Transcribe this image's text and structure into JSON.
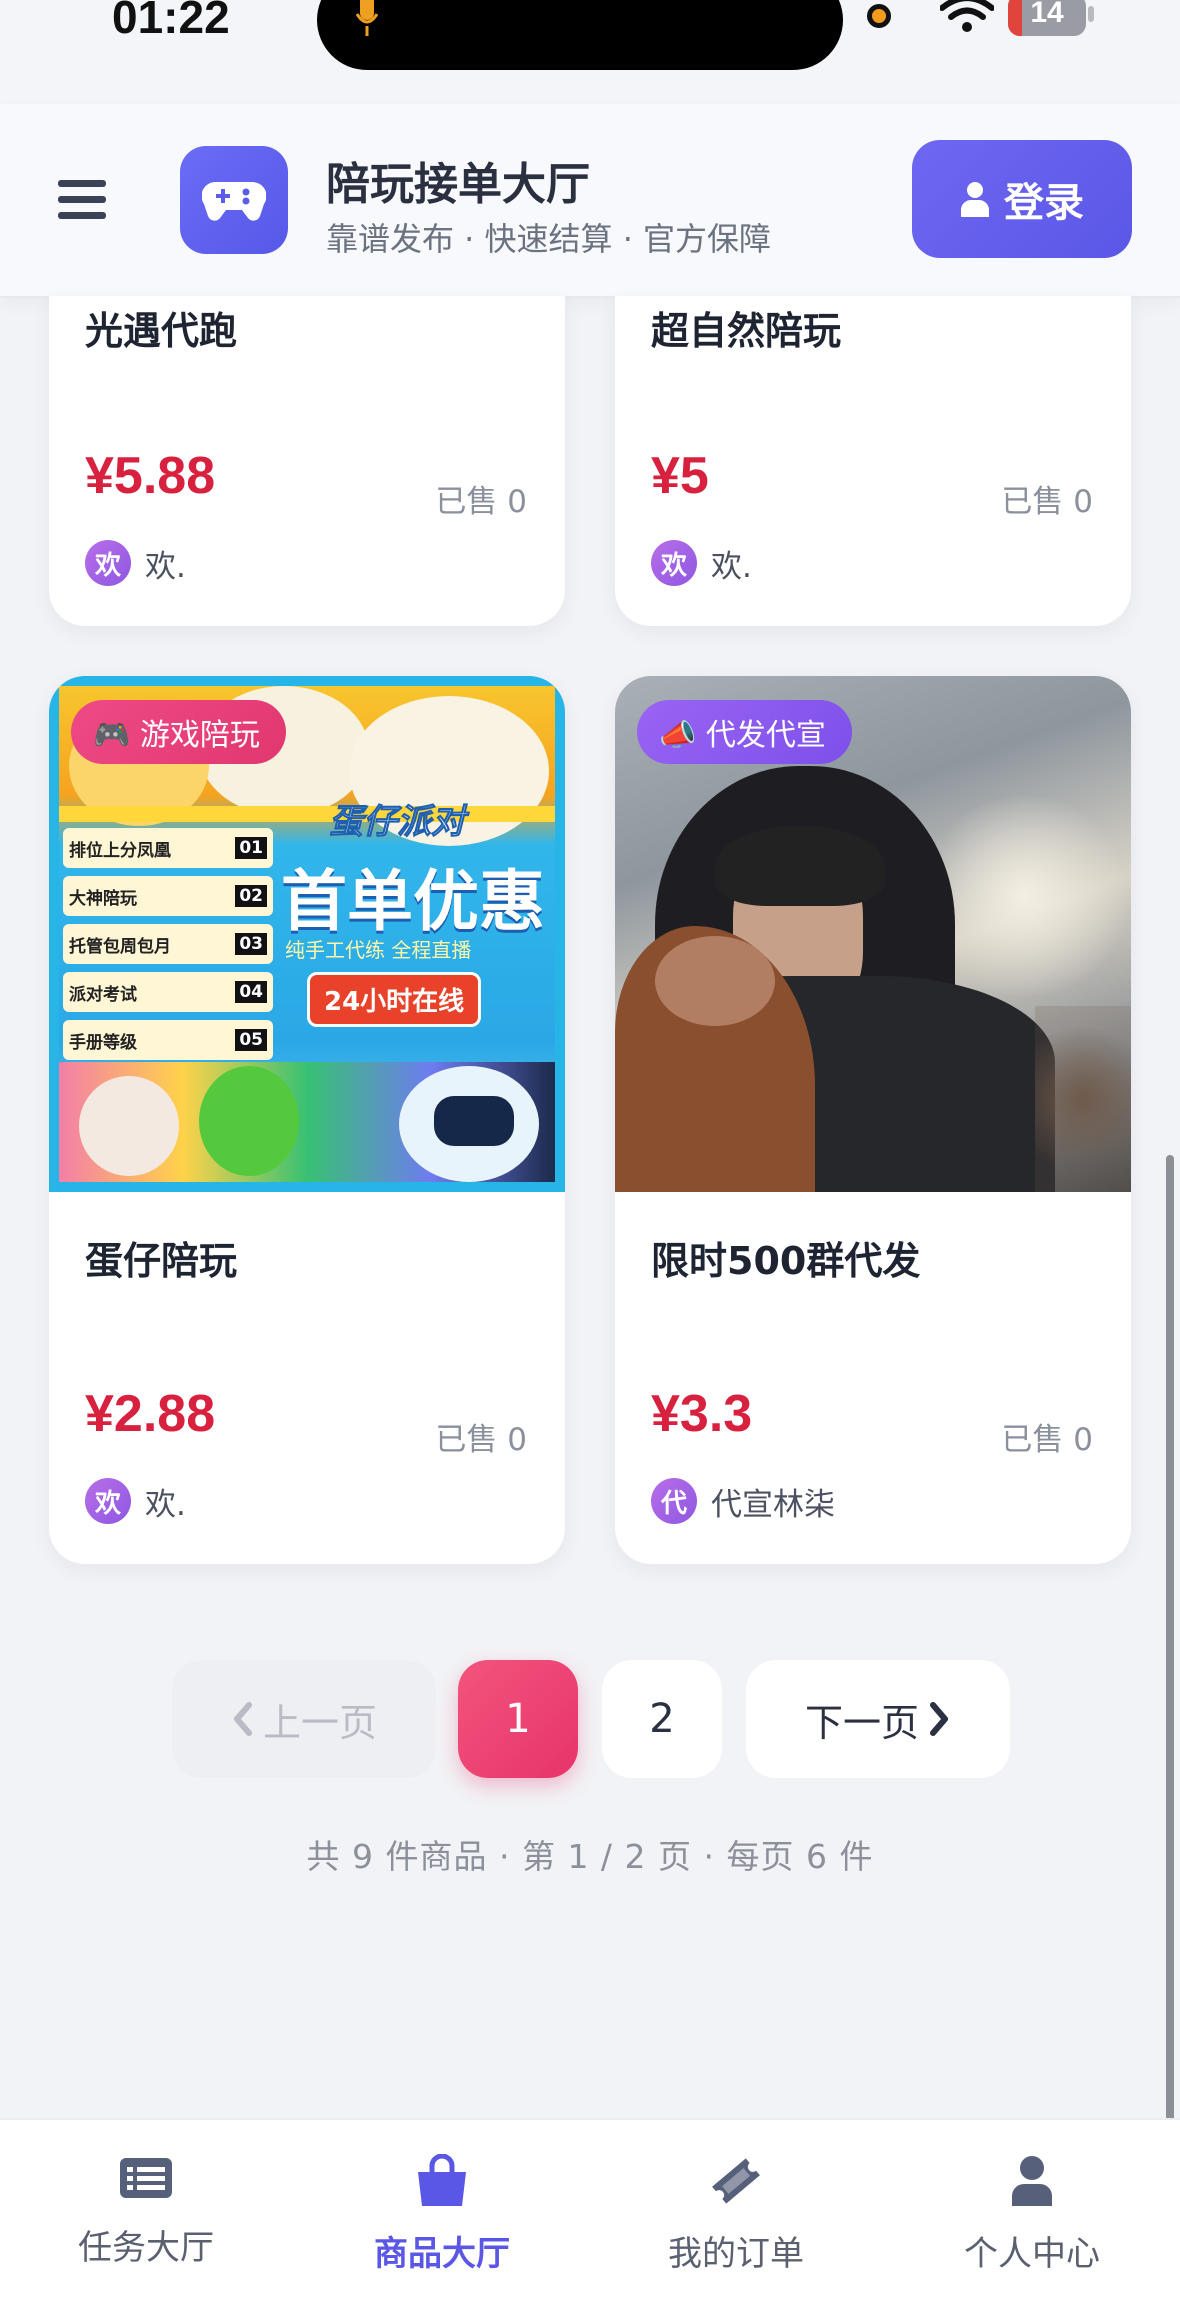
{
  "status": {
    "time": "01:22",
    "battery": "14"
  },
  "header": {
    "app_title": "陪玩接单大厅",
    "app_subtitle": "靠谱发布 · 快速结算 · 官方保障",
    "login_label": "登录"
  },
  "products": [
    {
      "title": "光遇代跑",
      "price": "¥5.88",
      "sold": "已售 0",
      "seller_avatar": "欢",
      "seller": "欢."
    },
    {
      "title": "超自然陪玩",
      "price": "¥5",
      "sold": "已售 0",
      "seller_avatar": "欢",
      "seller": "欢."
    },
    {
      "badge": "🎮 游戏陪玩",
      "title": "蛋仔陪玩",
      "price": "¥2.88",
      "sold": "已售 0",
      "seller_avatar": "欢",
      "seller": "欢.",
      "image_text": {
        "brand": "蛋仔派对",
        "headline": "首单优惠",
        "sub": "纯手工代练 全程直播",
        "cta": "24小时在线",
        "menu": [
          "排位上分凤凰",
          "大神陪玩",
          "托管包周包月",
          "派对考试",
          "手册等级"
        ],
        "menu_nums": [
          "01",
          "02",
          "03",
          "04",
          "05"
        ]
      }
    },
    {
      "badge": "📣 代发代宣",
      "title": "限时500群代发",
      "price": "¥3.3",
      "sold": "已售 0",
      "seller_avatar": "代",
      "seller": "代宣林柒"
    }
  ],
  "pagination": {
    "prev_label": "上一页",
    "pages": [
      "1",
      "2"
    ],
    "current": "1",
    "next_label": "下一页",
    "summary": "共 9 件商品 · 第 1 / 2 页 · 每页 6 件"
  },
  "tabbar": [
    {
      "label": "任务大厅",
      "icon": "list-icon",
      "active": false
    },
    {
      "label": "商品大厅",
      "icon": "shopping-bag-icon",
      "active": true
    },
    {
      "label": "我的订单",
      "icon": "ticket-icon",
      "active": false
    },
    {
      "label": "个人中心",
      "icon": "user-icon",
      "active": false
    }
  ],
  "colors": {
    "accent": "#5b57e6",
    "price": "#d8203f",
    "page_active": "#e8336a",
    "badge_game": "#e8417f",
    "badge_promo": "#8b5cf6"
  }
}
